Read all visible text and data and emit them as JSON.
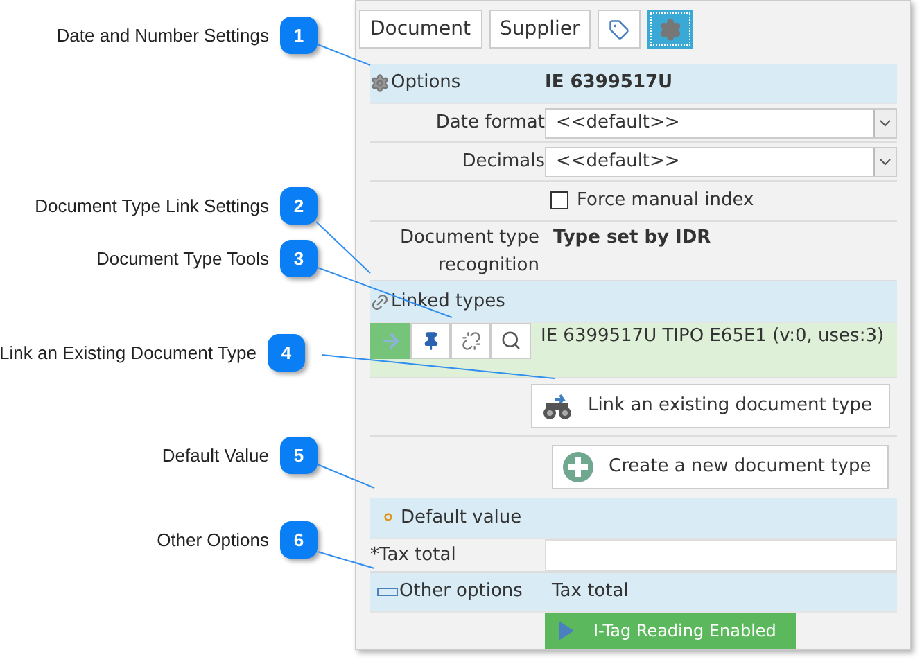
{
  "callouts": [
    {
      "number": "1",
      "label": "Date and Number Settings"
    },
    {
      "number": "2",
      "label": "Document Type Link Settings"
    },
    {
      "number": "3",
      "label": "Document Type Tools"
    },
    {
      "number": "4",
      "label": "Link an Existing Document Type"
    },
    {
      "number": "5",
      "label": "Default Value"
    },
    {
      "number": "6",
      "label": "Other Options"
    }
  ],
  "tabs": [
    {
      "kind": "text",
      "label": "Document",
      "selected": false
    },
    {
      "kind": "text",
      "label": "Supplier",
      "selected": false
    },
    {
      "kind": "tag",
      "selected": false
    },
    {
      "kind": "gear",
      "selected": true
    }
  ],
  "options": {
    "title": "Options",
    "value": "IE 6399517U",
    "fields": [
      {
        "label": "Date format",
        "value": "<<default>>"
      },
      {
        "label": "Decimals",
        "value": "<<default>>"
      }
    ],
    "checkbox": {
      "label": "Force manual index",
      "checked": false
    },
    "recognition": {
      "label": "Document type recognition",
      "value": "Type set by IDR"
    }
  },
  "linked_types": {
    "title": "Linked types",
    "tools": [
      {
        "kind": "arrow",
        "selected": true
      },
      {
        "kind": "pin",
        "selected": false
      },
      {
        "kind": "unlink",
        "selected": false
      },
      {
        "kind": "search",
        "selected": false
      }
    ],
    "type_name": "IE 6399517U TIPO E65E1 (v:0, uses:3)",
    "link_button": "Link an existing document type",
    "create_button": "Create a new document type"
  },
  "default_value": {
    "title": "Default value",
    "field_label": "*Tax total"
  },
  "other_options": {
    "title": "Other options",
    "value": "Tax total",
    "button": "I-Tag Reading Enabled"
  }
}
